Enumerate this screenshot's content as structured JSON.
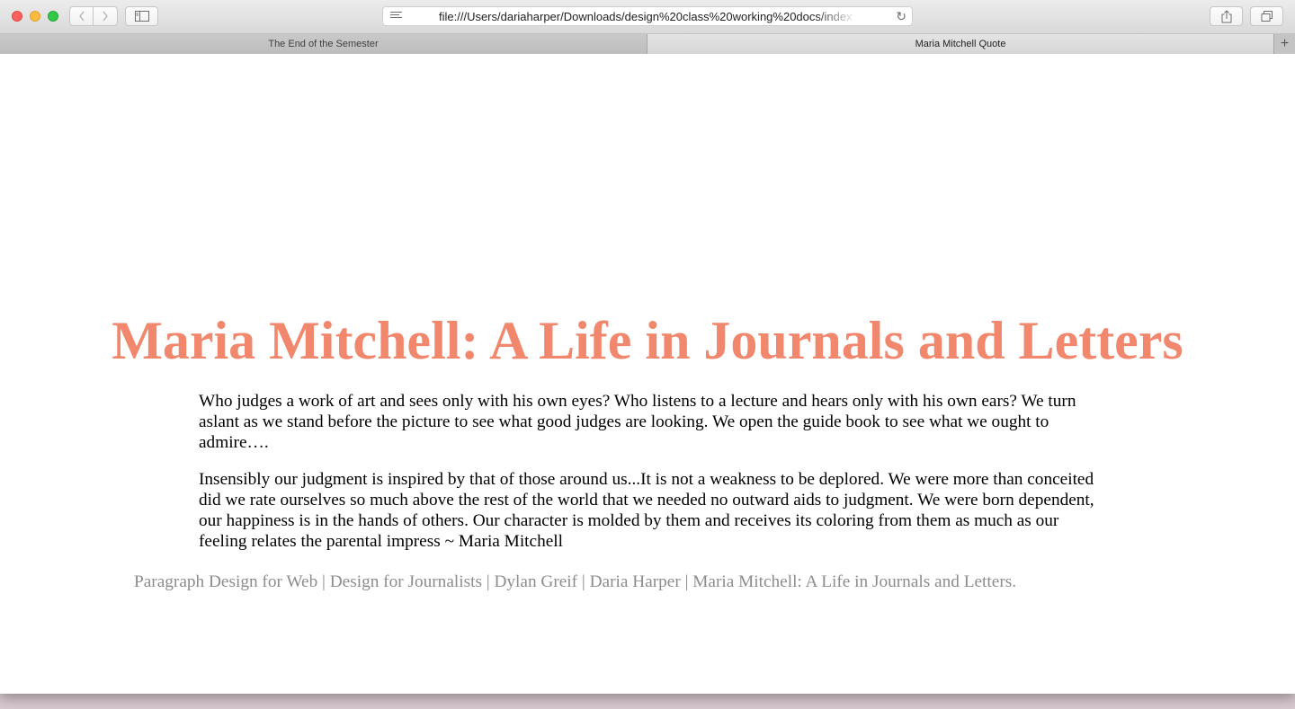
{
  "browser": {
    "url": "file:///Users/dariaharper/Downloads/design%20class%20working%20docs/index",
    "tabs": [
      {
        "label": "The End of the Semester",
        "active": false
      },
      {
        "label": "Maria Mitchell Quote",
        "active": true
      }
    ],
    "icons": {
      "back": "chevron-left-icon",
      "forward": "chevron-right-icon",
      "sidebar": "sidebar-icon",
      "reader": "reader-icon",
      "reload": "reload-icon",
      "share": "share-icon",
      "tabs": "tabs-overview-icon",
      "new_tab": "plus-icon"
    }
  },
  "page": {
    "title": "Maria Mitchell: A Life in Journals and Letters",
    "title_color": "#f1876d",
    "paragraphs": [
      "Who judges a work of art and sees only with his own eyes? Who listens to a lecture and hears only with his own ears? We turn aslant as we stand before the picture to see what good judges are looking. We open the guide book to see what we ought to admire….",
      "Insensibly our judgment is inspired by that of those around us...It is not a weakness to be deplored. We were more than conceited did we rate ourselves so much above the rest of the world that we needed no outward aids to judgment. We were born dependent, our happiness is in the hands of others. Our character is molded by them and receives its coloring from them as much as our feeling relates the parental impress ~ Maria Mitchell"
    ],
    "footer": "Paragraph Design for Web | Design for Journalists | Dylan Greif | Daria Harper | Maria Mitchell: A Life in Journals and Letters.",
    "footer_color": "#8c8c8c"
  }
}
